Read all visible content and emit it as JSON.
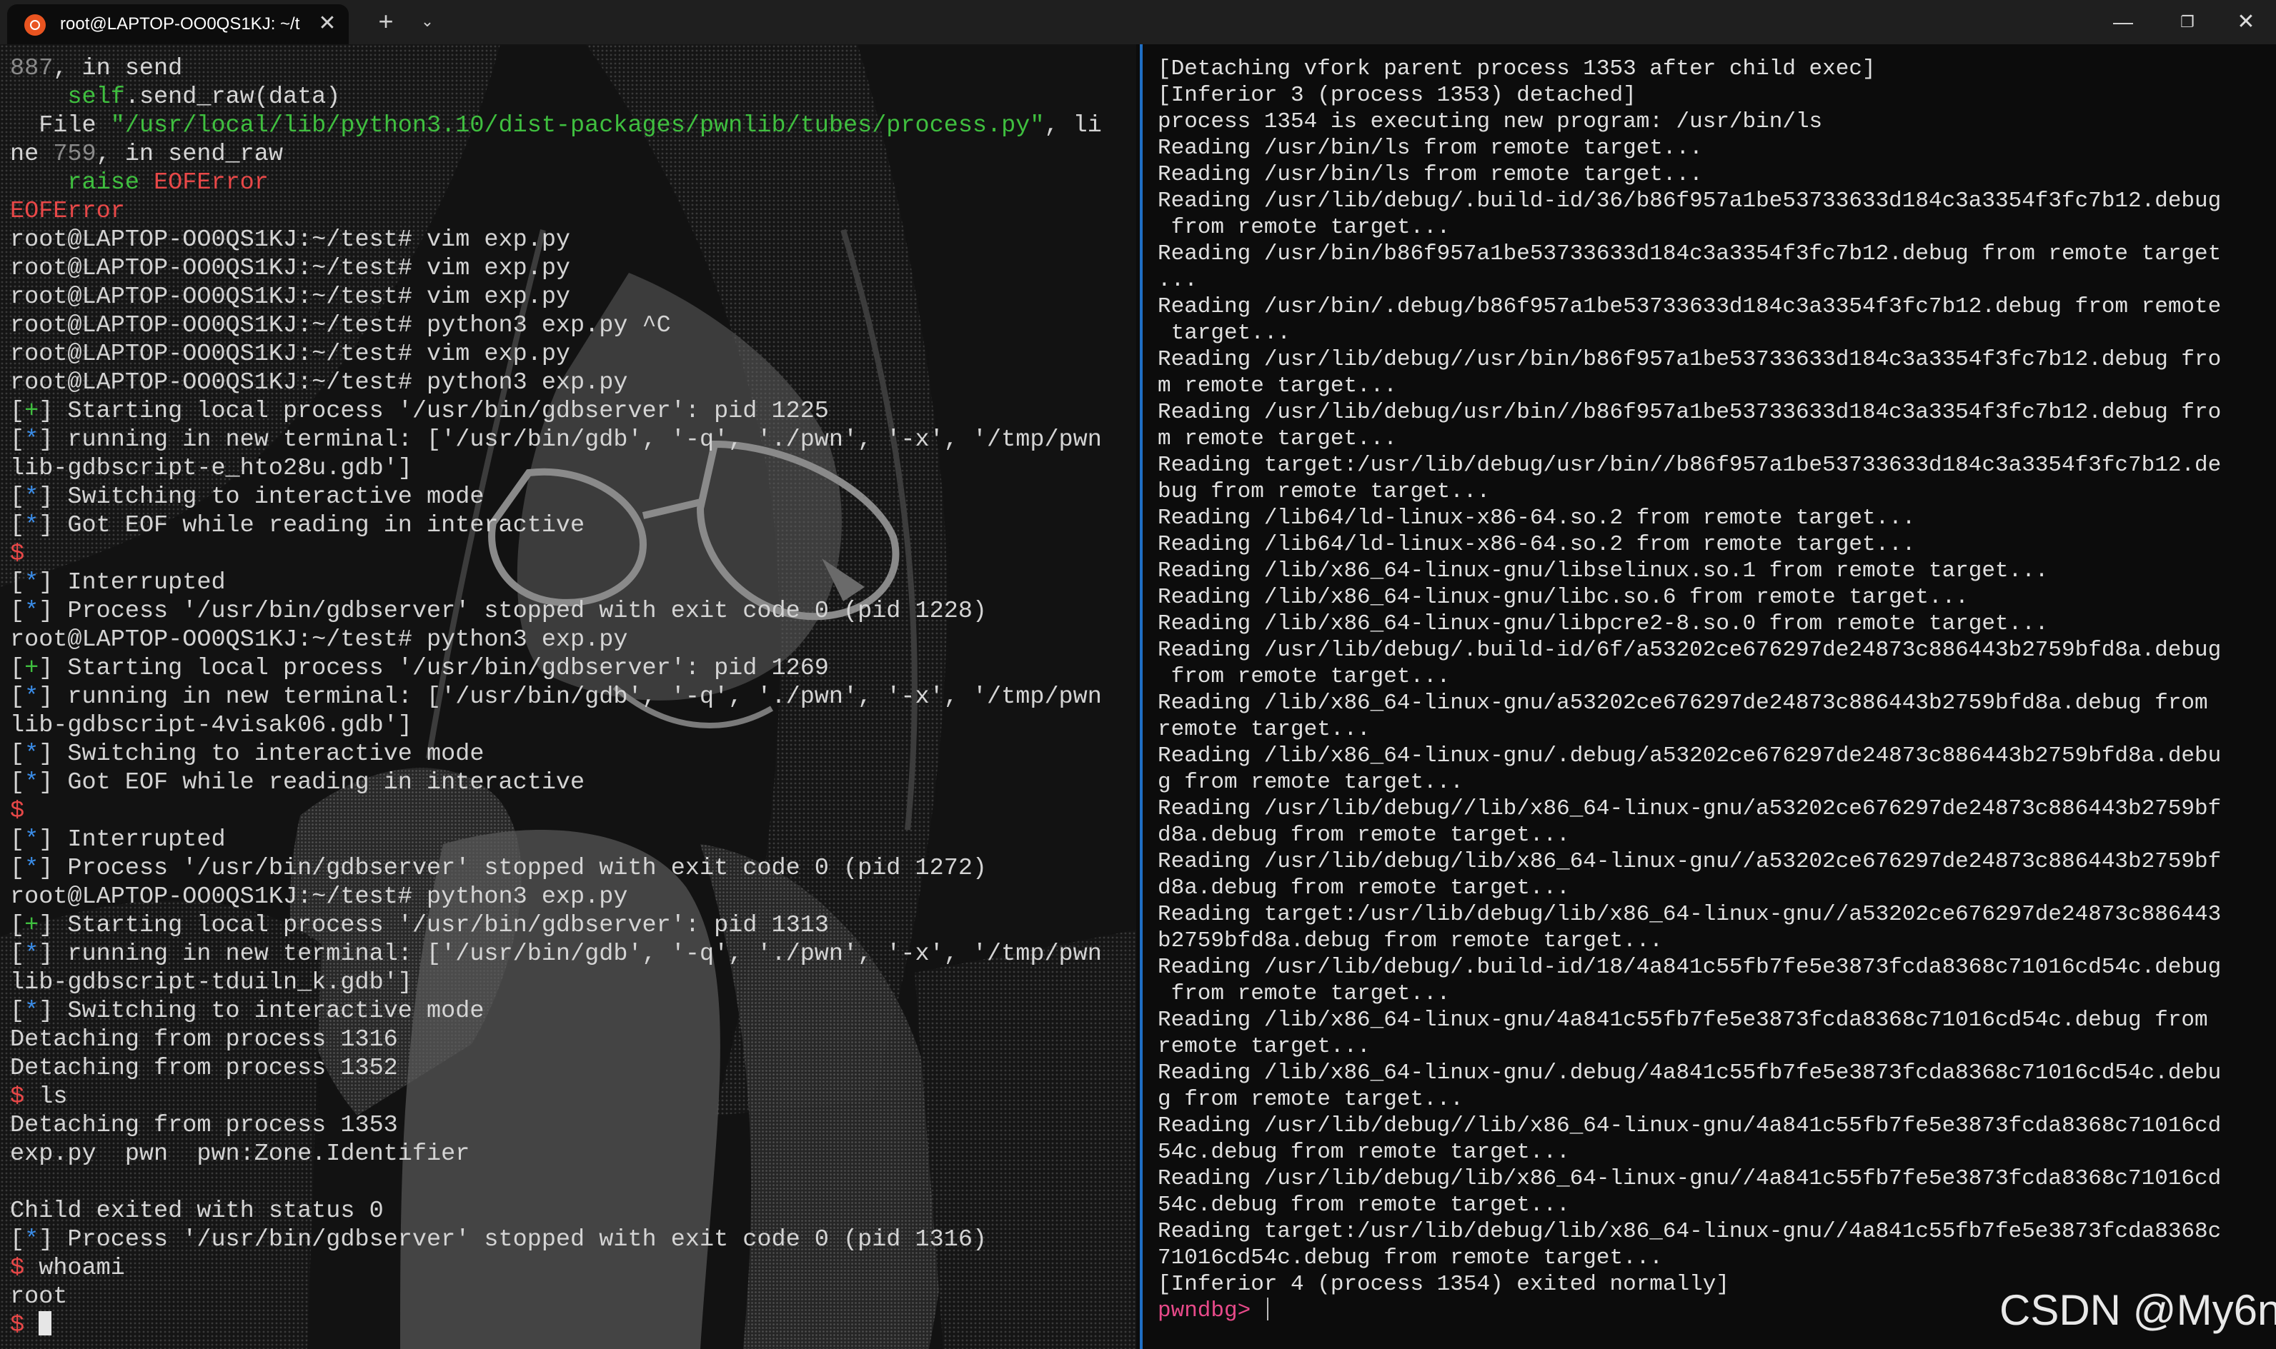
{
  "window": {
    "tab_title": "root@LAPTOP-OO0QS1KJ: ~/t",
    "tab_close": "✕",
    "new_tab": "+",
    "dropdown": "⌄",
    "minimize": "—",
    "maximize": "❐",
    "close": "✕"
  },
  "left_pane": {
    "lines": [
      [
        {
          "t": "887",
          "c": "dim"
        },
        {
          "t": ", in send"
        }
      ],
      [
        {
          "t": "    "
        },
        {
          "t": "self",
          "c": "green"
        },
        {
          "t": ".send_raw(data)"
        }
      ],
      [
        {
          "t": "  File "
        },
        {
          "t": "\"/usr/local/lib/python3.10/dist-packages/pwnlib/tubes/process.py\"",
          "c": "green"
        },
        {
          "t": ", li"
        }
      ],
      [
        {
          "t": "ne "
        },
        {
          "t": "759",
          "c": "dim"
        },
        {
          "t": ", in send_raw"
        }
      ],
      [
        {
          "t": "    "
        },
        {
          "t": "raise",
          "c": "green"
        },
        {
          "t": " "
        },
        {
          "t": "EOFError",
          "c": "red"
        }
      ],
      [
        {
          "t": "EOFError",
          "c": "red"
        }
      ],
      [
        {
          "t": "root@LAPTOP-OO0QS1KJ:~/test# vim exp.py"
        }
      ],
      [
        {
          "t": "root@LAPTOP-OO0QS1KJ:~/test# vim exp.py"
        }
      ],
      [
        {
          "t": "root@LAPTOP-OO0QS1KJ:~/test# vim exp.py"
        }
      ],
      [
        {
          "t": "root@LAPTOP-OO0QS1KJ:~/test# python3 exp.py ^C"
        }
      ],
      [
        {
          "t": "root@LAPTOP-OO0QS1KJ:~/test# vim exp.py"
        }
      ],
      [
        {
          "t": "root@LAPTOP-OO0QS1KJ:~/test# python3 exp.py"
        }
      ],
      [
        {
          "t": "["
        },
        {
          "t": "+",
          "c": "green"
        },
        {
          "t": "] Starting local process '/usr/bin/gdbserver': pid 1225"
        }
      ],
      [
        {
          "t": "["
        },
        {
          "t": "*",
          "c": "blue"
        },
        {
          "t": "] running in new terminal: ['/usr/bin/gdb', '-q', './pwn', '-x', '/tmp/pwn"
        }
      ],
      [
        {
          "t": "lib-gdbscript-e_hto28u.gdb']"
        }
      ],
      [
        {
          "t": "["
        },
        {
          "t": "*",
          "c": "blue"
        },
        {
          "t": "] Switching to interactive mode"
        }
      ],
      [
        {
          "t": "["
        },
        {
          "t": "*",
          "c": "blue"
        },
        {
          "t": "] Got EOF while reading in interactive"
        }
      ],
      [
        {
          "t": "$",
          "c": "red"
        }
      ],
      [
        {
          "t": "["
        },
        {
          "t": "*",
          "c": "blue"
        },
        {
          "t": "] Interrupted"
        }
      ],
      [
        {
          "t": "["
        },
        {
          "t": "*",
          "c": "blue"
        },
        {
          "t": "] Process '/usr/bin/gdbserver' stopped with exit code 0 (pid 1228)"
        }
      ],
      [
        {
          "t": "root@LAPTOP-OO0QS1KJ:~/test# python3 exp.py"
        }
      ],
      [
        {
          "t": "["
        },
        {
          "t": "+",
          "c": "green"
        },
        {
          "t": "] Starting local process '/usr/bin/gdbserver': pid 1269"
        }
      ],
      [
        {
          "t": "["
        },
        {
          "t": "*",
          "c": "blue"
        },
        {
          "t": "] running in new terminal: ['/usr/bin/gdb', '-q', './pwn', '-x', '/tmp/pwn"
        }
      ],
      [
        {
          "t": "lib-gdbscript-4visak06.gdb']"
        }
      ],
      [
        {
          "t": "["
        },
        {
          "t": "*",
          "c": "blue"
        },
        {
          "t": "] Switching to interactive mode"
        }
      ],
      [
        {
          "t": "["
        },
        {
          "t": "*",
          "c": "blue"
        },
        {
          "t": "] Got EOF while reading in interactive"
        }
      ],
      [
        {
          "t": "$",
          "c": "red"
        }
      ],
      [
        {
          "t": "["
        },
        {
          "t": "*",
          "c": "blue"
        },
        {
          "t": "] Interrupted"
        }
      ],
      [
        {
          "t": "["
        },
        {
          "t": "*",
          "c": "blue"
        },
        {
          "t": "] Process '/usr/bin/gdbserver' stopped with exit code 0 (pid 1272)"
        }
      ],
      [
        {
          "t": "root@LAPTOP-OO0QS1KJ:~/test# python3 exp.py"
        }
      ],
      [
        {
          "t": "["
        },
        {
          "t": "+",
          "c": "green"
        },
        {
          "t": "] Starting local process '/usr/bin/gdbserver': pid 1313"
        }
      ],
      [
        {
          "t": "["
        },
        {
          "t": "*",
          "c": "blue"
        },
        {
          "t": "] running in new terminal: ['/usr/bin/gdb', '-q', './pwn', '-x', '/tmp/pwn"
        }
      ],
      [
        {
          "t": "lib-gdbscript-tduiln_k.gdb']"
        }
      ],
      [
        {
          "t": "["
        },
        {
          "t": "*",
          "c": "blue"
        },
        {
          "t": "] Switching to interactive mode"
        }
      ],
      [
        {
          "t": "Detaching from process 1316"
        }
      ],
      [
        {
          "t": "Detaching from process 1352"
        }
      ],
      [
        {
          "t": "$",
          "c": "red"
        },
        {
          "t": " ls"
        }
      ],
      [
        {
          "t": "Detaching from process 1353"
        }
      ],
      [
        {
          "t": "exp.py  pwn  pwn:Zone.Identifier"
        }
      ],
      [
        {
          "t": ""
        }
      ],
      [
        {
          "t": "Child exited with status 0"
        }
      ],
      [
        {
          "t": "["
        },
        {
          "t": "*",
          "c": "blue"
        },
        {
          "t": "] Process '/usr/bin/gdbserver' stopped with exit code 0 (pid 1316)"
        }
      ],
      [
        {
          "t": "$",
          "c": "red"
        },
        {
          "t": " whoami"
        }
      ],
      [
        {
          "t": "root"
        }
      ],
      [
        {
          "t": "$ ",
          "c": "red"
        },
        {
          "t": "",
          "cursor": "block"
        }
      ]
    ]
  },
  "right_pane": {
    "lines": [
      [
        {
          "t": "[Detaching vfork parent process 1353 after child exec]"
        }
      ],
      [
        {
          "t": "[Inferior 3 (process 1353) detached]"
        }
      ],
      [
        {
          "t": "process 1354 is executing new program: /usr/bin/ls"
        }
      ],
      [
        {
          "t": "Reading /usr/bin/ls from remote target..."
        }
      ],
      [
        {
          "t": "Reading /usr/bin/ls from remote target..."
        }
      ],
      [
        {
          "t": "Reading /usr/lib/debug/.build-id/36/b86f957a1be53733633d184c3a3354f3fc7b12.debug"
        }
      ],
      [
        {
          "t": " from remote target..."
        }
      ],
      [
        {
          "t": "Reading /usr/bin/b86f957a1be53733633d184c3a3354f3fc7b12.debug from remote target"
        }
      ],
      [
        {
          "t": "..."
        }
      ],
      [
        {
          "t": "Reading /usr/bin/.debug/b86f957a1be53733633d184c3a3354f3fc7b12.debug from remote"
        }
      ],
      [
        {
          "t": " target..."
        }
      ],
      [
        {
          "t": "Reading /usr/lib/debug//usr/bin/b86f957a1be53733633d184c3a3354f3fc7b12.debug fro"
        }
      ],
      [
        {
          "t": "m remote target..."
        }
      ],
      [
        {
          "t": "Reading /usr/lib/debug/usr/bin//b86f957a1be53733633d184c3a3354f3fc7b12.debug fro"
        }
      ],
      [
        {
          "t": "m remote target..."
        }
      ],
      [
        {
          "t": "Reading target:/usr/lib/debug/usr/bin//b86f957a1be53733633d184c3a3354f3fc7b12.de"
        }
      ],
      [
        {
          "t": "bug from remote target..."
        }
      ],
      [
        {
          "t": "Reading /lib64/ld-linux-x86-64.so.2 from remote target..."
        }
      ],
      [
        {
          "t": "Reading /lib64/ld-linux-x86-64.so.2 from remote target..."
        }
      ],
      [
        {
          "t": "Reading /lib/x86_64-linux-gnu/libselinux.so.1 from remote target..."
        }
      ],
      [
        {
          "t": "Reading /lib/x86_64-linux-gnu/libc.so.6 from remote target..."
        }
      ],
      [
        {
          "t": "Reading /lib/x86_64-linux-gnu/libpcre2-8.so.0 from remote target..."
        }
      ],
      [
        {
          "t": "Reading /usr/lib/debug/.build-id/6f/a53202ce676297de24873c886443b2759bfd8a.debug"
        }
      ],
      [
        {
          "t": " from remote target..."
        }
      ],
      [
        {
          "t": "Reading /lib/x86_64-linux-gnu/a53202ce676297de24873c886443b2759bfd8a.debug from"
        }
      ],
      [
        {
          "t": "remote target..."
        }
      ],
      [
        {
          "t": "Reading /lib/x86_64-linux-gnu/.debug/a53202ce676297de24873c886443b2759bfd8a.debu"
        }
      ],
      [
        {
          "t": "g from remote target..."
        }
      ],
      [
        {
          "t": "Reading /usr/lib/debug//lib/x86_64-linux-gnu/a53202ce676297de24873c886443b2759bf"
        }
      ],
      [
        {
          "t": "d8a.debug from remote target..."
        }
      ],
      [
        {
          "t": "Reading /usr/lib/debug/lib/x86_64-linux-gnu//a53202ce676297de24873c886443b2759bf"
        }
      ],
      [
        {
          "t": "d8a.debug from remote target..."
        }
      ],
      [
        {
          "t": "Reading target:/usr/lib/debug/lib/x86_64-linux-gnu//a53202ce676297de24873c886443"
        }
      ],
      [
        {
          "t": "b2759bfd8a.debug from remote target..."
        }
      ],
      [
        {
          "t": "Reading /usr/lib/debug/.build-id/18/4a841c55fb7fe5e3873fcda8368c71016cd54c.debug"
        }
      ],
      [
        {
          "t": " from remote target..."
        }
      ],
      [
        {
          "t": "Reading /lib/x86_64-linux-gnu/4a841c55fb7fe5e3873fcda8368c71016cd54c.debug from"
        }
      ],
      [
        {
          "t": "remote target..."
        }
      ],
      [
        {
          "t": "Reading /lib/x86_64-linux-gnu/.debug/4a841c55fb7fe5e3873fcda8368c71016cd54c.debu"
        }
      ],
      [
        {
          "t": "g from remote target..."
        }
      ],
      [
        {
          "t": "Reading /usr/lib/debug//lib/x86_64-linux-gnu/4a841c55fb7fe5e3873fcda8368c71016cd"
        }
      ],
      [
        {
          "t": "54c.debug from remote target..."
        }
      ],
      [
        {
          "t": "Reading /usr/lib/debug/lib/x86_64-linux-gnu//4a841c55fb7fe5e3873fcda8368c71016cd"
        }
      ],
      [
        {
          "t": "54c.debug from remote target..."
        }
      ],
      [
        {
          "t": "Reading target:/usr/lib/debug/lib/x86_64-linux-gnu//4a841c55fb7fe5e3873fcda8368c"
        }
      ],
      [
        {
          "t": "71016cd54c.debug from remote target..."
        }
      ],
      [
        {
          "t": "[Inferior 4 (process 1354) exited normally]"
        }
      ],
      [
        {
          "t": "pwndbg> ",
          "c": "pink"
        },
        {
          "t": "",
          "cursor": "bar"
        }
      ]
    ]
  },
  "watermark": "CSDN @My6n",
  "colors": {
    "background": "#0c0c0c",
    "titlebar": "#1f1f1f",
    "pane_divider": "#1f6fc5",
    "prompt_red": "#e84848",
    "status_green": "#3fbf3f",
    "status_blue": "#3b8eea",
    "pwndbg_prompt": "#e84a8a"
  },
  "icons": {
    "tab_icon": "ubuntu-icon",
    "background_art": "manga-girl-with-glasses"
  }
}
